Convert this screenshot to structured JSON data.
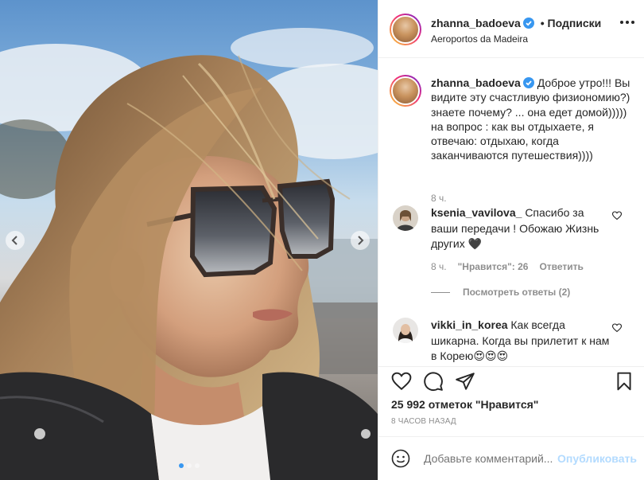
{
  "post": {
    "username": "zhanna_badoeva",
    "follow_label": "• Подписки",
    "location": "Aeroportos da Madeira"
  },
  "caption": {
    "username": "zhanna_badoeva",
    "text": "Доброе утро!!! Вы видите эту счастливую физиономию?) знаете почему? ... она едет домой))))) на вопрос : как вы отдыхаете, я отвечаю: отдыхаю, когда заканчиваются путешествия))))",
    "time": "8 ч."
  },
  "comments": [
    {
      "username": "ksenia_vavilova_",
      "text": "Спасибо за ваши передачи ! Обожаю Жизнь других 🖤",
      "time": "8 ч.",
      "likes": "\"Нравится\": 26",
      "reply_label": "Ответить",
      "view_replies": "Посмотреть ответы (2)"
    },
    {
      "username": "vikki_in_korea",
      "text": "Как всегда шикарна. Когда вы прилетит к нам в Корею😍😍😍"
    }
  ],
  "likes_count": "25 992 отметок \"Нравится\"",
  "posted_ago": "8 часов назад",
  "add_comment": {
    "placeholder": "Добавьте комментарий...",
    "publish_label": "Опубликовать"
  },
  "carousel": {
    "slide_count": 3,
    "active_slide": 1
  },
  "colors": {
    "link_blue": "#3897f0",
    "publish_disabled": "#b3dbff",
    "text": "#262626",
    "muted": "#8e8e8e",
    "verified": "#3897f0"
  },
  "icons": [
    "chevron-left-icon",
    "chevron-right-icon",
    "more-options-icon",
    "verified-badge-icon",
    "heart-icon",
    "comment-icon",
    "share-icon",
    "bookmark-icon",
    "emoji-icon"
  ]
}
